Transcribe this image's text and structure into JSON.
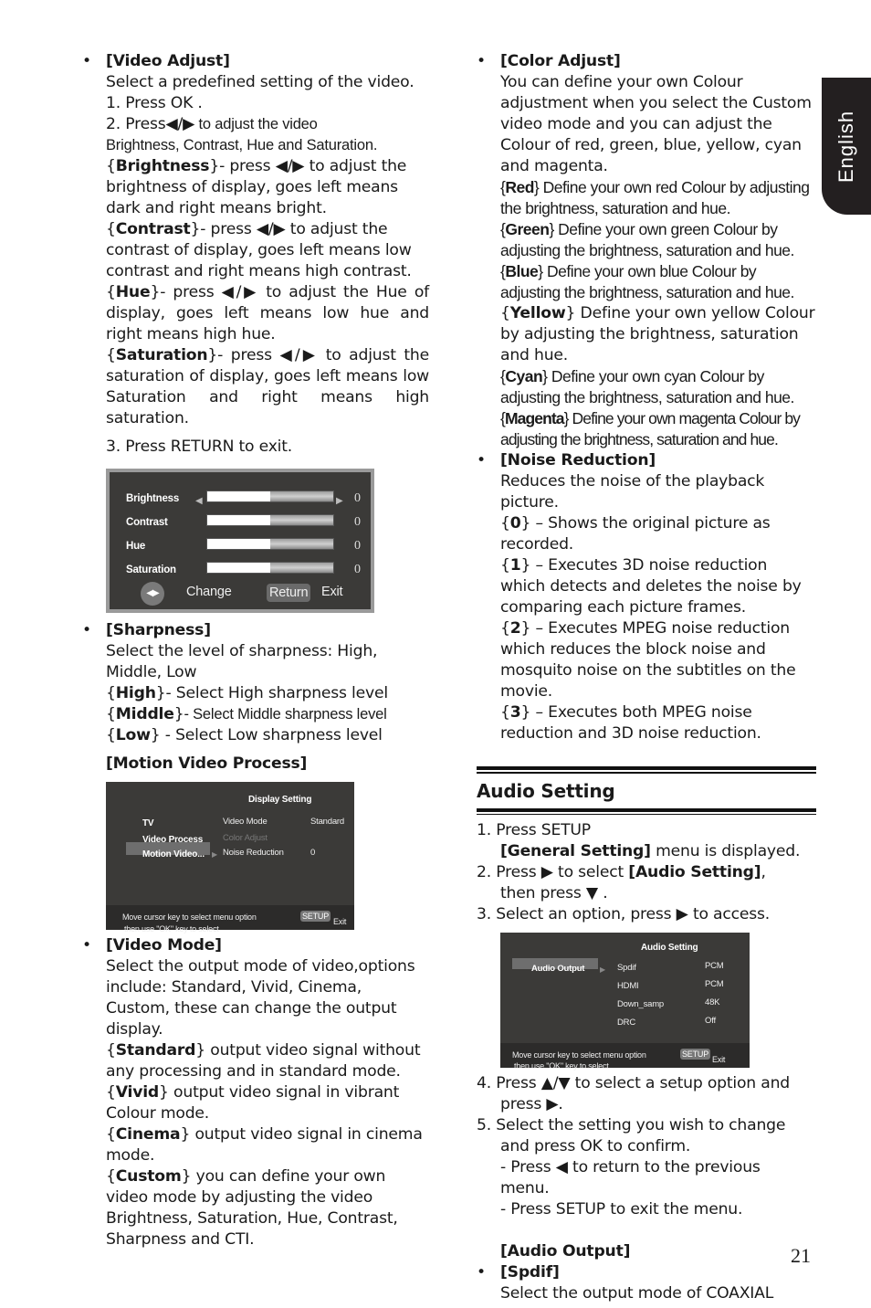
{
  "side_tab": {
    "label": "English"
  },
  "page_number": "21",
  "left": {
    "video_adjust": {
      "title": "[Video Adjust]",
      "intro": "Select a predefined setting of the video.",
      "step1": "1. Press OK .",
      "step2a": "2. Press◀/▶",
      "step2b": " to adjust the video",
      "step2c": "Brightness, Contrast, Hue and Saturation.",
      "brightness": {
        "term": "Brightness",
        "text": "- press ◀/▶ to adjust the brightness of display, goes left means dark and right means bright."
      },
      "contrast": {
        "term": "Contrast",
        "text": "-  press ◀/▶ to adjust the contrast of display, goes left means low contrast and right means high contrast."
      },
      "hue": {
        "term": "Hue",
        "text": "- press ◀/▶ to adjust the Hue of display, goes left means low hue and right means high hue."
      },
      "saturation": {
        "term": "Saturation",
        "text": "- press ◀/▶ to adjust the saturation of display, goes left  means low Saturation and right means high saturation."
      },
      "step3": "3. Press RETURN to exit.",
      "osd": {
        "rows": [
          {
            "label": "Brightness",
            "value": "0",
            "level": 0.5
          },
          {
            "label": "Contrast",
            "value": "0",
            "level": 0.5
          },
          {
            "label": "Hue",
            "value": "0",
            "level": 0.5
          },
          {
            "label": "Saturation",
            "value": "0",
            "level": 0.5
          }
        ],
        "change_icon": "◀▶",
        "change_label": "Change",
        "return_label": "Return",
        "exit_label": "Exit"
      }
    },
    "sharpness": {
      "title": "[Sharpness]",
      "intro": "Select the level of sharpness: High, Middle, Low",
      "high": {
        "term": "High",
        "text": "- Select High sharpness level"
      },
      "middle": {
        "term": "Middle",
        "text": "- Select Middle sharpness level"
      },
      "low": {
        "term": "Low",
        "text": " - Select Low sharpness level"
      },
      "motion_title": "[Motion Video Process]",
      "osd": {
        "title": "Display Setting",
        "menu": [
          "TV",
          "Video Process",
          "Motion Video..."
        ],
        "options": [
          {
            "label": "Video Mode",
            "value": "Standard",
            "disabled": false
          },
          {
            "label": "Color Adjust",
            "value": "",
            "disabled": true
          },
          {
            "label": "Noise Reduction",
            "value": "0",
            "disabled": false
          }
        ],
        "footer_line1": "Move cursor key to select menu option",
        "footer_line2": "then use \"OK\" key to select",
        "setup_tag": "SETUP",
        "exit_label": "Exit"
      }
    },
    "video_mode": {
      "title": "[Video Mode]",
      "intro": "Select the output mode of video,options include: Standard, Vivid, Cinema, Custom, these can change the output display.",
      "standard": {
        "term": "Standard",
        "text": " output video signal without any processing and in standard mode."
      },
      "vivid": {
        "term": "Vivid",
        "text": " output video signal in vibrant Colour mode."
      },
      "cinema": {
        "term": "Cinema",
        "text": " output video signal in cinema mode."
      },
      "custom": {
        "term": "Custom",
        "text": " you can define your own video mode by adjusting the video Brightness, Saturation, Hue, Contrast, Sharpness and CTI."
      }
    }
  },
  "right": {
    "color_adjust": {
      "title": "[Color Adjust]",
      "intro": "You can define your own Colour adjustment when you select the Custom video mode and you can adjust the Colour of red, green, blue, yellow, cyan and magenta.",
      "red": {
        "term": "Red",
        "text": " Define your own red Colour by adjusting the brightness, saturation and hue."
      },
      "green": {
        "term": "Green",
        "text": " Define your own green Colour by adjusting the brightness, saturation and hue."
      },
      "blue": {
        "term": "Blue",
        "text": " Define your own blue Colour by adjusting the brightness, saturation and hue."
      },
      "yellow": {
        "term": "Yellow",
        "text": " Define your own yellow Colour by adjusting the brightness, saturation and hue."
      },
      "cyan": {
        "term": "Cyan",
        "text": " Define your own cyan Colour by adjusting the brightness, saturation and hue."
      },
      "magenta": {
        "term": "Magenta",
        "text": " Define your own magenta Colour by adjusting the brightness, saturation and hue."
      }
    },
    "noise_reduction": {
      "title": "[Noise Reduction]",
      "intro": "Reduces the noise of the playback picture.",
      "opt0": {
        "term": "0",
        "text": " – Shows the original picture as recorded."
      },
      "opt1": {
        "term": "1",
        "text": " – Executes 3D noise reduction which detects and deletes the noise by comparing each picture frames."
      },
      "opt2": {
        "term": "2",
        "text": " – Executes MPEG noise reduction which reduces the block noise and mosquito noise on the subtitles on the movie."
      },
      "opt3": {
        "term": "3",
        "text": " – Executes both MPEG noise reduction and 3D noise reduction."
      }
    },
    "audio_setting": {
      "heading": "Audio Setting",
      "step1": "1. Press SETUP",
      "step1b_bold": "[General Setting]",
      "step1b_rest": " menu is displayed.",
      "step2a": "2. Press ▶ to select ",
      "step2_bold": "[Audio Setting]",
      "step2_end": ",",
      "step2b": "then press ▼ .",
      "step3": "3. Select an option, press ▶ to access.",
      "osd": {
        "title": "Audio Setting",
        "menu": [
          "Audio Output"
        ],
        "options": [
          {
            "label": "Spdif",
            "value": "PCM"
          },
          {
            "label": "HDMI",
            "value": "PCM"
          },
          {
            "label": "Down_samp",
            "value": "48K"
          },
          {
            "label": "DRC",
            "value": "Off"
          }
        ],
        "footer_line1": "Move cursor key to select menu option",
        "footer_line2": "then use \"OK\" key to select",
        "setup_tag": "SETUP",
        "exit_label": "Exit"
      },
      "step4a": "4. Press ▲/▼ to select a setup option and",
      "step4b": "press ▶.",
      "step5a": "5. Select the setting you wish to change",
      "step5b": "and press OK to confirm.",
      "step5c": "- Press ◀ to return to the previous",
      "step5d": "menu.",
      "step5e": "- Press SETUP to exit the menu.",
      "audio_output_title": "[Audio Output]",
      "spdif_title": "[Spdif]",
      "spdif_text": "Select the output mode of COAXIAL"
    }
  }
}
